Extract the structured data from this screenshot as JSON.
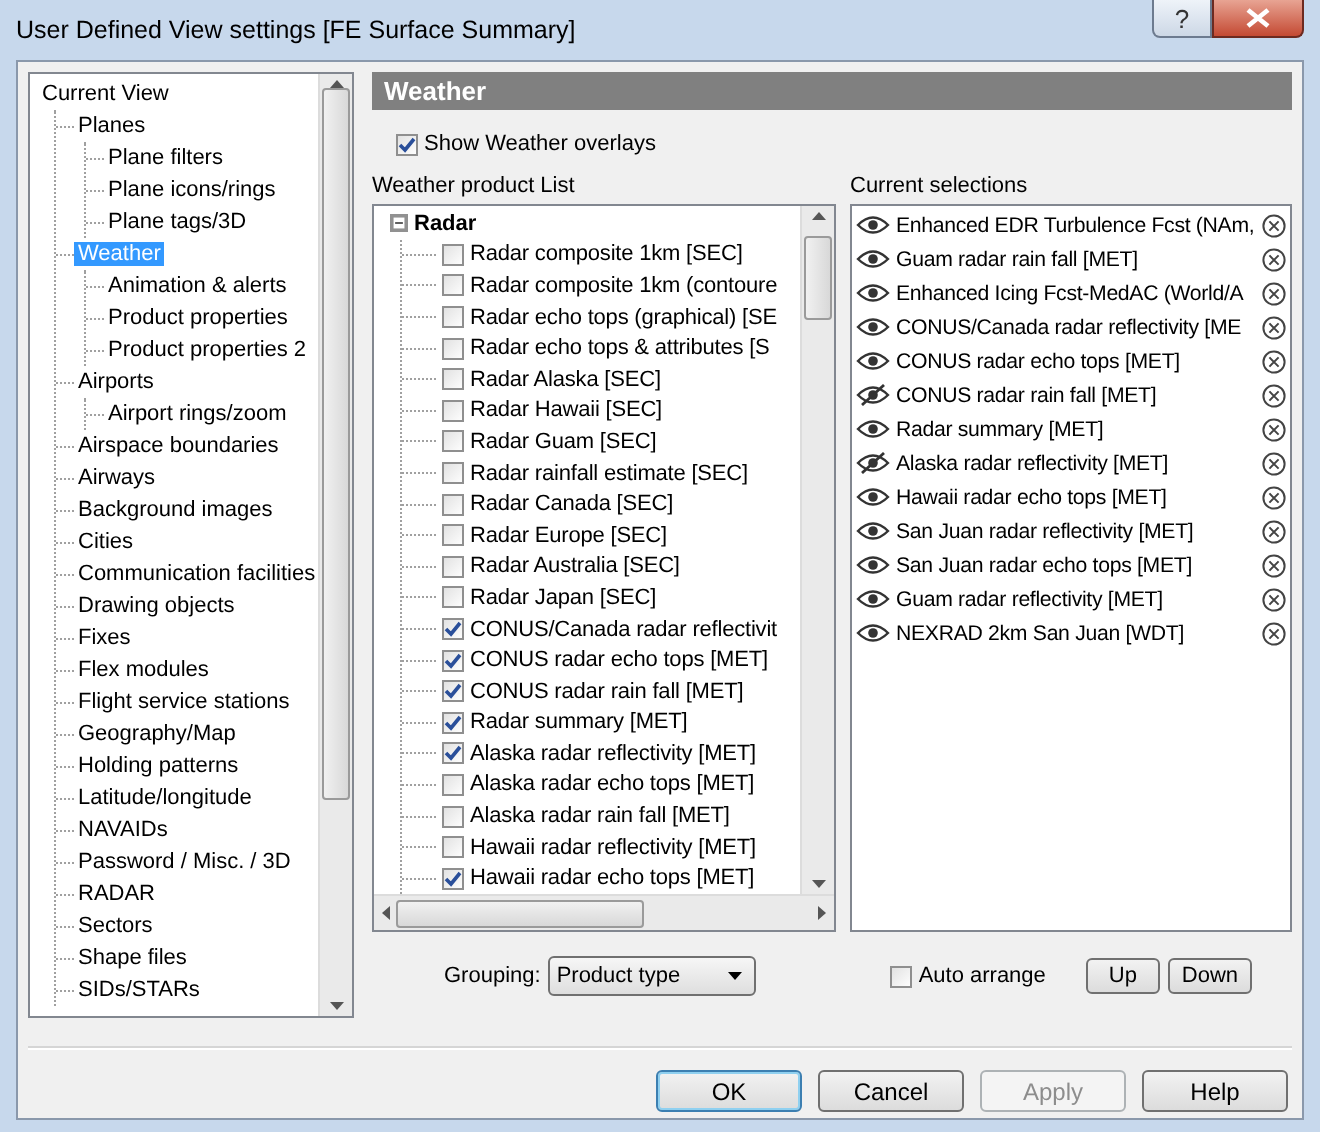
{
  "window": {
    "title": "User Defined View settings  [FE Surface Summary]",
    "help_button": "?"
  },
  "tree": [
    {
      "label": "Current View",
      "selected": false,
      "children": [
        {
          "label": "Planes",
          "selected": false,
          "children": [
            {
              "label": "Plane filters",
              "selected": false
            },
            {
              "label": "Plane icons/rings",
              "selected": false
            },
            {
              "label": "Plane tags/3D",
              "selected": false
            }
          ]
        },
        {
          "label": "Weather",
          "selected": true,
          "children": [
            {
              "label": "Animation & alerts",
              "selected": false
            },
            {
              "label": "Product properties",
              "selected": false
            },
            {
              "label": "Product properties 2",
              "selected": false
            }
          ]
        },
        {
          "label": "Airports",
          "selected": false,
          "children": [
            {
              "label": "Airport rings/zoom",
              "selected": false
            }
          ]
        },
        {
          "label": "Airspace boundaries",
          "selected": false
        },
        {
          "label": "Airways",
          "selected": false
        },
        {
          "label": "Background images",
          "selected": false
        },
        {
          "label": "Cities",
          "selected": false
        },
        {
          "label": "Communication facilities",
          "selected": false
        },
        {
          "label": "Drawing objects",
          "selected": false
        },
        {
          "label": "Fixes",
          "selected": false
        },
        {
          "label": "Flex modules",
          "selected": false
        },
        {
          "label": "Flight service stations",
          "selected": false
        },
        {
          "label": "Geography/Map",
          "selected": false
        },
        {
          "label": "Holding patterns",
          "selected": false
        },
        {
          "label": "Latitude/longitude",
          "selected": false
        },
        {
          "label": "NAVAIDs",
          "selected": false
        },
        {
          "label": "Password / Misc. / 3D",
          "selected": false
        },
        {
          "label": "RADAR",
          "selected": false
        },
        {
          "label": "Sectors",
          "selected": false
        },
        {
          "label": "Shape files",
          "selected": false
        },
        {
          "label": "SIDs/STARs",
          "selected": false
        }
      ]
    }
  ],
  "panel": {
    "title": "Weather",
    "show_overlays": {
      "label": "Show Weather overlays",
      "checked": true
    }
  },
  "product_list": {
    "label": "Weather product List",
    "groups": [
      {
        "label": "Radar",
        "expanded": true,
        "items": [
          {
            "label": "Radar composite 1km [SEC]",
            "checked": false
          },
          {
            "label": "Radar composite 1km (contoure",
            "checked": false
          },
          {
            "label": "Radar echo tops (graphical) [SE",
            "checked": false
          },
          {
            "label": "Radar echo tops & attributes [S",
            "checked": false
          },
          {
            "label": "Radar Alaska [SEC]",
            "checked": false
          },
          {
            "label": "Radar Hawaii [SEC]",
            "checked": false
          },
          {
            "label": "Radar Guam [SEC]",
            "checked": false
          },
          {
            "label": "Radar rainfall estimate [SEC]",
            "checked": false
          },
          {
            "label": "Radar Canada [SEC]",
            "checked": false
          },
          {
            "label": "Radar Europe [SEC]",
            "checked": false
          },
          {
            "label": "Radar Australia [SEC]",
            "checked": false
          },
          {
            "label": "Radar Japan [SEC]",
            "checked": false
          },
          {
            "label": "CONUS/Canada radar reflectivit",
            "checked": true
          },
          {
            "label": "CONUS radar echo tops [MET]",
            "checked": true
          },
          {
            "label": "CONUS radar rain fall [MET]",
            "checked": true
          },
          {
            "label": "Radar summary [MET]",
            "checked": true
          },
          {
            "label": "Alaska radar reflectivity [MET]",
            "checked": true
          },
          {
            "label": "Alaska radar echo tops [MET]",
            "checked": false
          },
          {
            "label": "Alaska radar rain fall [MET]",
            "checked": false
          },
          {
            "label": "Hawaii radar reflectivity [MET]",
            "checked": false
          },
          {
            "label": "Hawaii radar echo tops [MET]",
            "checked": true
          }
        ]
      }
    ]
  },
  "selections": {
    "label": "Current selections",
    "items": [
      {
        "label": "Enhanced EDR Turbulence Fcst (NAm,",
        "visible": true
      },
      {
        "label": "Guam radar rain fall [MET]",
        "visible": true
      },
      {
        "label": "Enhanced Icing Fcst-MedAC (World/A",
        "visible": true
      },
      {
        "label": "CONUS/Canada radar reflectivity [ME",
        "visible": true
      },
      {
        "label": "CONUS radar echo tops [MET]",
        "visible": true
      },
      {
        "label": "CONUS radar rain fall [MET]",
        "visible": false
      },
      {
        "label": "Radar summary [MET]",
        "visible": true
      },
      {
        "label": "Alaska radar reflectivity [MET]",
        "visible": false
      },
      {
        "label": "Hawaii radar echo tops [MET]",
        "visible": true
      },
      {
        "label": "San Juan radar reflectivity [MET]",
        "visible": true
      },
      {
        "label": "San Juan radar echo tops [MET]",
        "visible": true
      },
      {
        "label": "Guam radar reflectivity [MET]",
        "visible": true
      },
      {
        "label": "NEXRAD 2km San Juan [WDT]",
        "visible": true
      }
    ]
  },
  "grouping": {
    "label": "Grouping:",
    "value": "Product type"
  },
  "auto_arrange": {
    "label": "Auto arrange",
    "checked": false
  },
  "order_buttons": [
    "Up",
    "Down"
  ],
  "buttons": [
    {
      "label": "OK",
      "default": true,
      "disabled": false
    },
    {
      "label": "Cancel",
      "default": false,
      "disabled": false
    },
    {
      "label": "Apply",
      "default": false,
      "disabled": true
    },
    {
      "label": "Help",
      "default": false,
      "disabled": false
    }
  ]
}
